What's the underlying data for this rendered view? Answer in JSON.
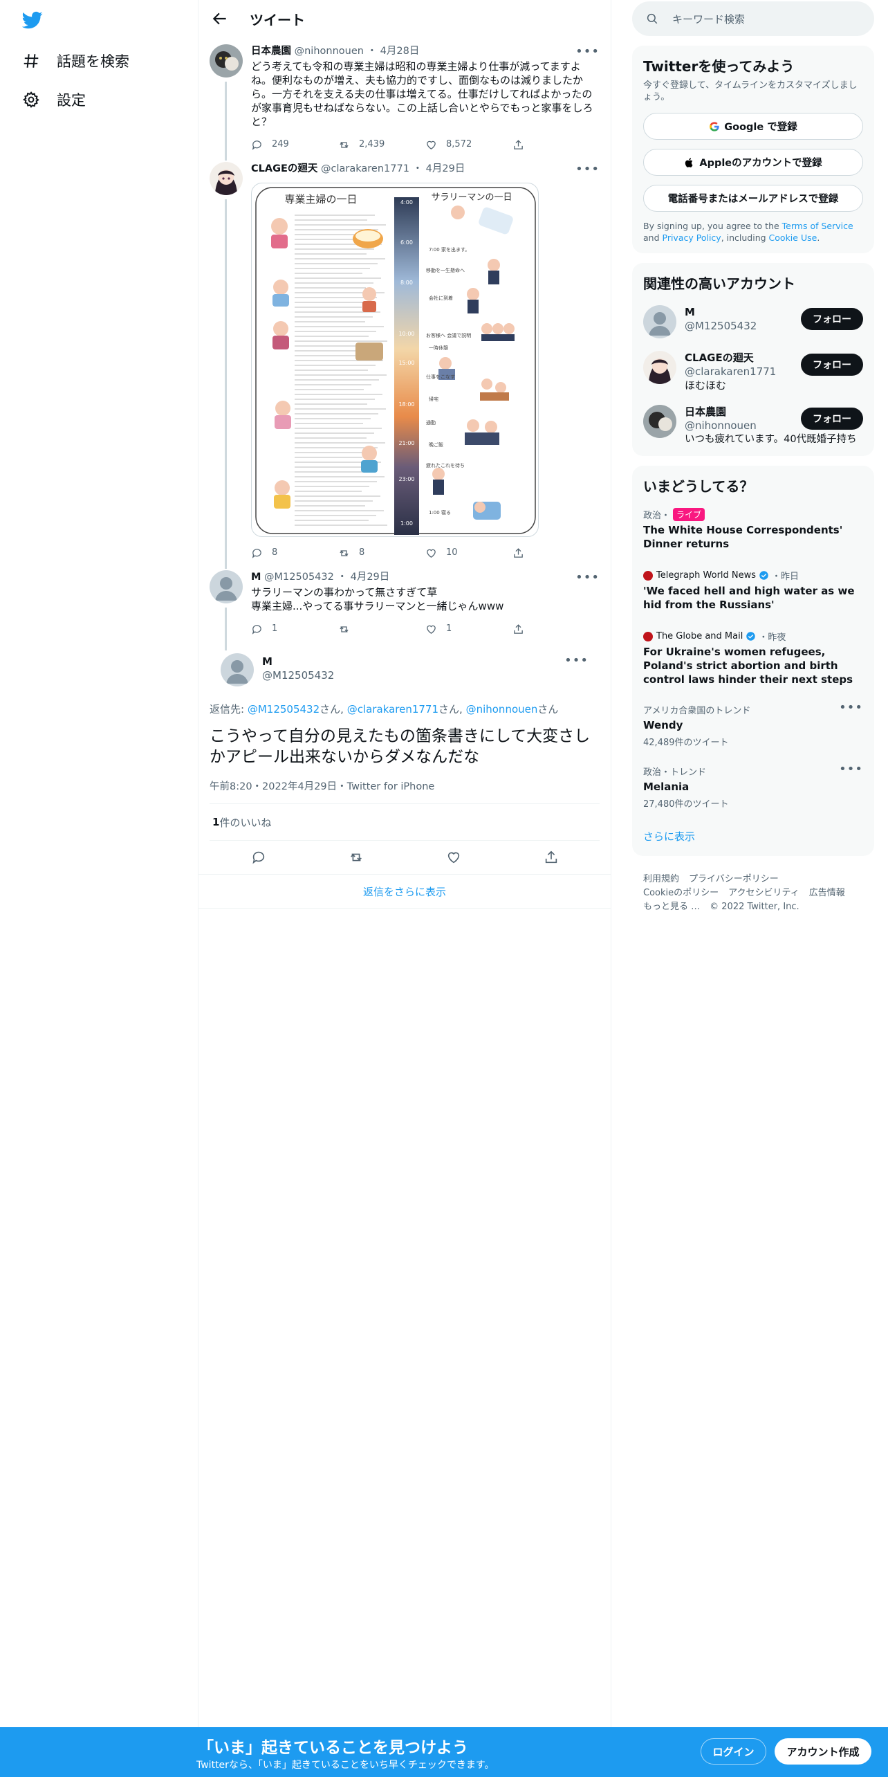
{
  "nav": {
    "explore_label": "話題を検索",
    "settings_label": "設定"
  },
  "header": {
    "title": "ツイート"
  },
  "tweets": [
    {
      "name": "日本農園",
      "handle": "@nihonnouen",
      "date": "4月28日",
      "text": "どう考えても令和の専業主婦は昭和の専業主婦より仕事が減ってますよね。便利なものが増え、夫も協力的ですし、面倒なものは減りましたから。一方それを支える夫の仕事は増えてる。仕事だけしてればよかったのが家事育児もせねばならない。この上話し合いとやらでもっと家事をしろと？",
      "replies": "249",
      "retweets": "2,439",
      "likes": "8,572"
    },
    {
      "name": "CLAGEの廻天",
      "handle": "@clarakaren1771",
      "date": "4月29日",
      "replies": "8",
      "retweets": "8",
      "likes": "10",
      "image": {
        "left_title": "専業主婦の一日",
        "right_title": "サラリーマンの一日",
        "times": [
          "4:00",
          "6:00",
          "8:00",
          "10:00",
          "15:00",
          "18:00",
          "21:00",
          "23:00",
          "1:00"
        ],
        "right_notes": [
          "7:00 家を出ます。",
          "移動を一生懸命へ",
          "会社に到着",
          "お客様へ 会議で説明",
          "一時休憩",
          "仕事をこなす",
          "帰宅",
          "通勤",
          "晩ご飯",
          "疲れたこれを待ち",
          "1:00 寝る"
        ]
      }
    },
    {
      "name": "M",
      "handle": "@M12505432",
      "date": "4月29日",
      "text_lines": [
        "サラリーマンの事わかって無さすぎて草",
        "専業主婦...やってる事サラリーマンと一緒じゃんwww"
      ],
      "replies": "1",
      "retweets": "",
      "likes": "1"
    }
  ],
  "focus": {
    "name": "M",
    "handle": "@M12505432",
    "reply_to_prefix": "返信先: ",
    "reply_to": [
      "@M12505432",
      "@clarakaren1771",
      "@nihonnouen"
    ],
    "reply_suffix": "さん",
    "text": "こうやって自分の見えたもの箇条書きにして大変さしかアピール出来ないからダメなんだな",
    "meta": "午前8:20・2022年4月29日・Twitter for iPhone",
    "likes_count": "1",
    "likes_label": " 件のいいね",
    "show_more": "返信をさらに表示"
  },
  "sidebar": {
    "search_placeholder": "キーワード検索",
    "signup": {
      "title": "Twitterを使ってみよう",
      "subtitle": "今すぐ登録して、タイムラインをカスタマイズしましょう。",
      "google": "Google で登録",
      "apple": "Appleのアカウントで登録",
      "phone": "電話番号またはメールアドレスで登録",
      "legal_1": "By signing up, you agree to the ",
      "tos": "Terms of Service",
      "legal_2": " and ",
      "privacy": "Privacy Policy",
      "legal_3": ", including ",
      "cookie": "Cookie Use",
      "legal_4": "."
    },
    "relevant": {
      "title": "関連性の高いアカウント",
      "follow_label": "フォロー",
      "accounts": [
        {
          "name": "M",
          "handle": "@M12505432",
          "bio": ""
        },
        {
          "name": "CLAGEの廻天",
          "handle": "@clarakaren1771",
          "bio": "ほむほむ"
        },
        {
          "name": "日本農園",
          "handle": "@nihonnouen",
          "bio": "いつも疲れています。40代既婚子持ち"
        }
      ]
    },
    "trends": {
      "title": "いまどうしてる？",
      "items": [
        {
          "context": "政治・",
          "badge": "ライブ",
          "title": "The White House Correspondents' Dinner returns"
        },
        {
          "source": "Telegraph World News",
          "time": "・昨日",
          "title": "'We faced hell and high water as we hid from the Russians'"
        },
        {
          "source": "The Globe and Mail",
          "time": "・昨夜",
          "title": "For Ukraine's women refugees, Poland's strict abortion and birth control laws hinder their next steps"
        },
        {
          "context": "アメリカ合衆国のトレンド",
          "title": "Wendy",
          "count": "42,489件のツイート"
        },
        {
          "context": "政治・トレンド",
          "title": "Melania",
          "count": "27,480件のツイート"
        }
      ],
      "show_more": "さらに表示"
    },
    "footer": {
      "links": [
        "利用規約",
        "プライバシーポリシー",
        "Cookieのポリシー",
        "アクセシビリティ",
        "広告情報",
        "もっと見る …"
      ],
      "copyright": "© 2022 Twitter, Inc."
    }
  },
  "banner": {
    "title": "「いま」起きていることを見つけよう",
    "subtitle": "Twitterなら、「いま」起きていることをいち早くチェックできます。",
    "login": "ログイン",
    "signup": "アカウント作成"
  },
  "colors": {
    "accent": "#1d9bf0",
    "text": "#0f1419",
    "muted": "#536471",
    "live": "#f91880"
  }
}
